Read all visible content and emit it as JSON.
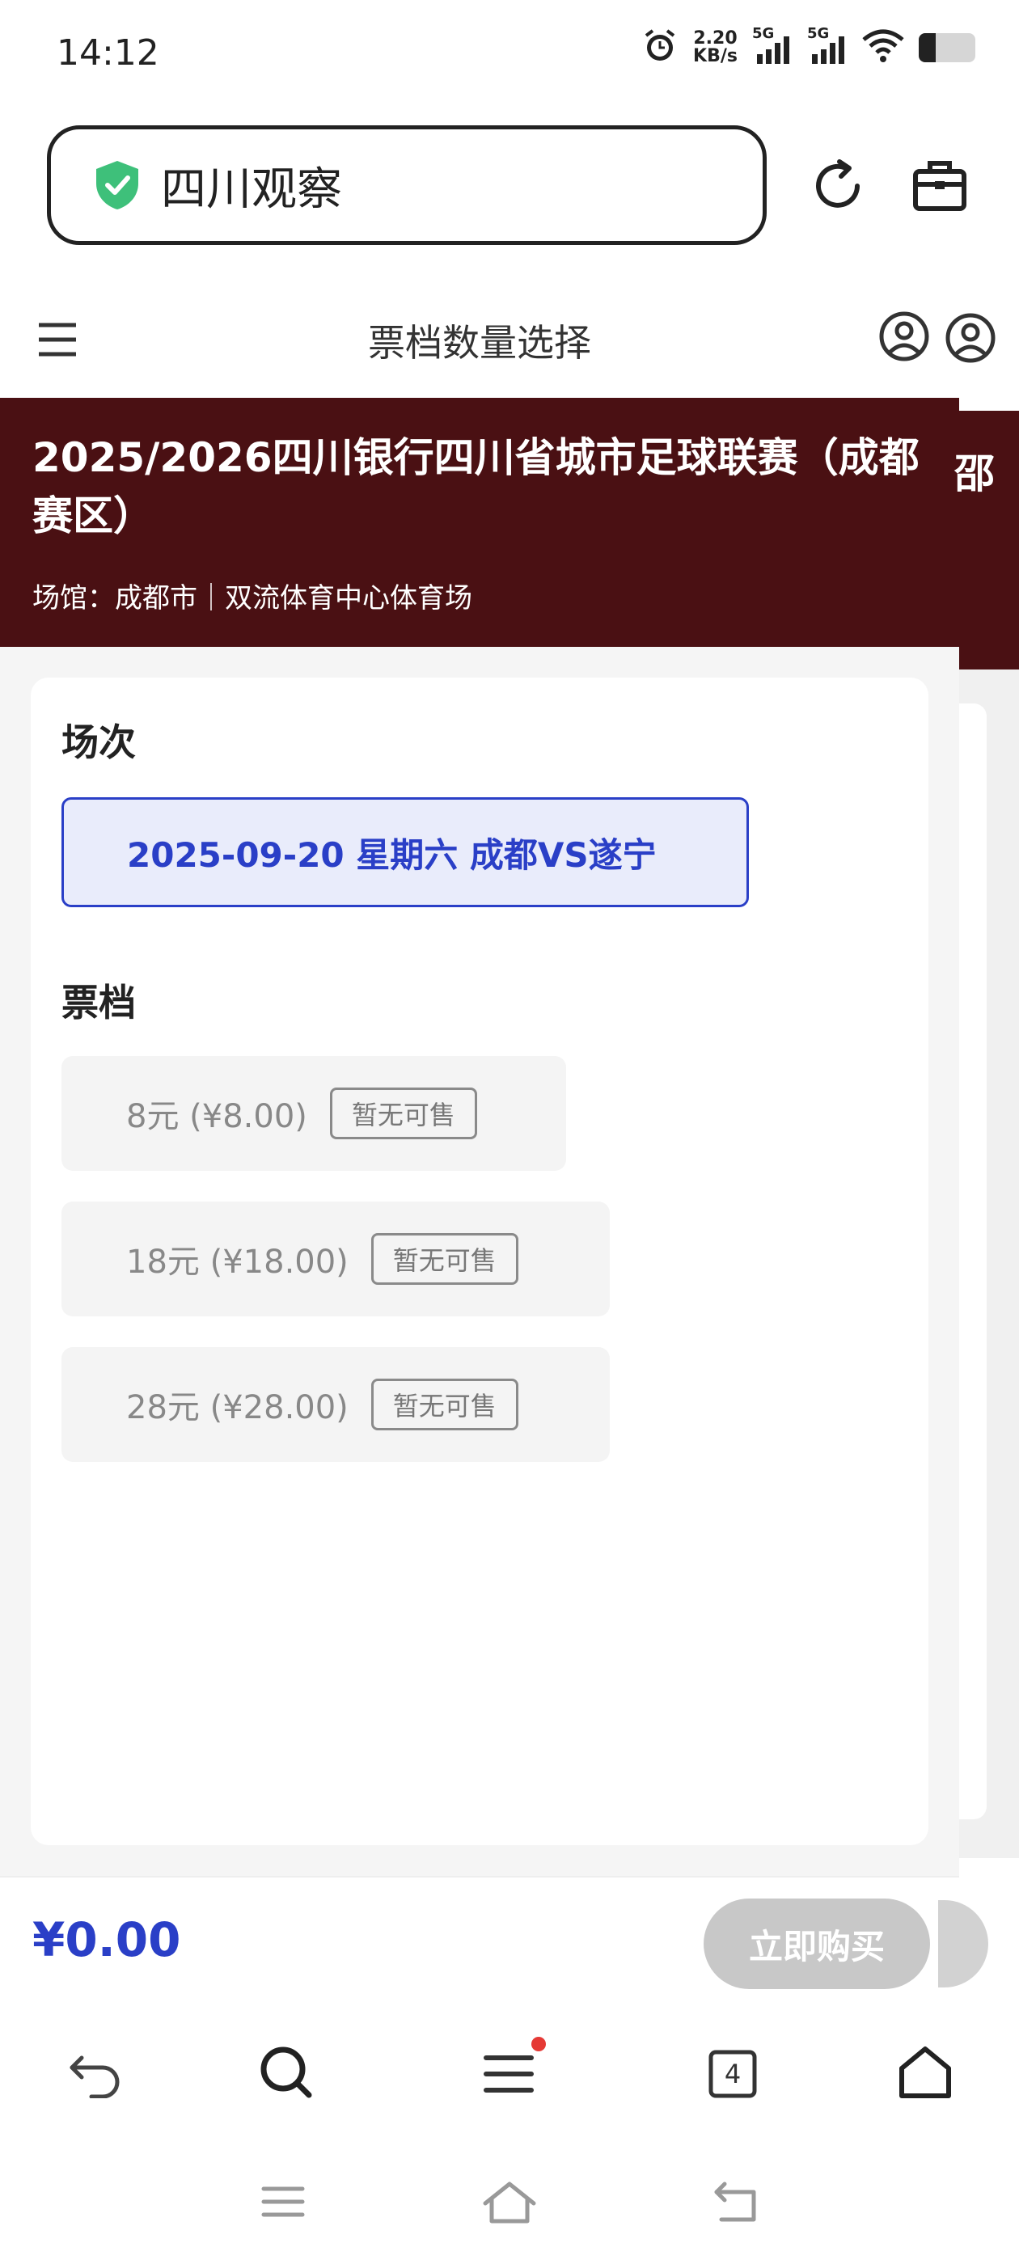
{
  "status_bar": {
    "time": "14:12",
    "net_speed_value": "2.20",
    "net_speed_unit": "KB/s",
    "sim1": "5G",
    "sim2": "5G",
    "battery_level": 0.3
  },
  "address_bar": {
    "site_title": "四川观察",
    "secure_icon": "shield-check-icon",
    "accent_color": "#3ec07a"
  },
  "page_nav": {
    "title": "票档数量选择"
  },
  "event": {
    "title": "2025/2026四川银行四川省城市足球联赛（成都赛区）",
    "venue": "场馆：成都市｜双流体育中心体育场",
    "side_peek": "邵"
  },
  "session": {
    "label": "场次",
    "selected": "2025-09-20 星期六 成都VS遂宁"
  },
  "tiers": {
    "label": "票档",
    "items": [
      {
        "name": "8元 (¥8.00)",
        "status": "暂无可售"
      },
      {
        "name": "18元 (¥18.00)",
        "status": "暂无可售"
      },
      {
        "name": "28元 (¥28.00)",
        "status": "暂无可售"
      }
    ]
  },
  "purchase": {
    "total": "¥0.00",
    "buy_label": "立即购买",
    "accent_color": "#2a3fc7"
  },
  "toolbar": {
    "tabs_count": "4",
    "menu_badge_color": "#e53935"
  }
}
